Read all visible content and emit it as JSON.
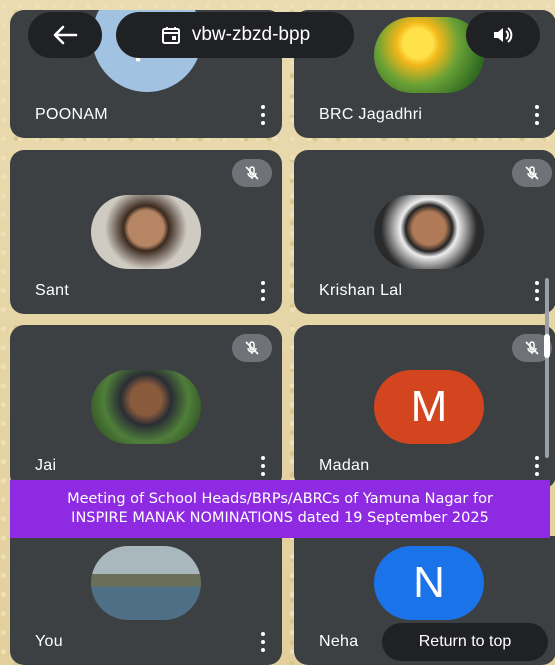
{
  "meeting": {
    "code": "vbw-zbzd-bpp"
  },
  "participants": [
    {
      "name": "POONAM",
      "initial": "P"
    },
    {
      "name": "BRC Jagadhri"
    },
    {
      "name": "Sant"
    },
    {
      "name": "Krishan Lal"
    },
    {
      "name": "Jai"
    },
    {
      "name": "Madan",
      "initial": "M"
    },
    {
      "name": "You"
    },
    {
      "name": "Neha",
      "initial": "N"
    }
  ],
  "banner": {
    "line1": "Meeting of School Heads/BRPs/ABRCs of Yamuna Nagar for",
    "line2": "INSPIRE MANAK NOMINATIONS dated 19 September 2025"
  },
  "return_to_top": "Return to top",
  "colors": {
    "tile": "#3c4043",
    "banner": "#8e2be2",
    "madan": "#d2451e",
    "neha": "#1a73e8",
    "poonam": "#a1c2e0"
  },
  "icons": {
    "back": "arrow-left-icon",
    "meeting": "calendar-icon",
    "speaker": "volume-icon",
    "mic": "mic-off-icon",
    "more": "more-vertical-icon"
  }
}
